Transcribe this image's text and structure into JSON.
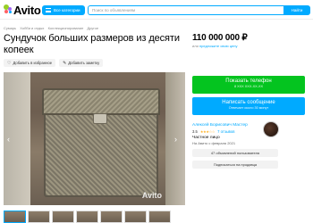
{
  "header": {
    "logo_text": "Avito",
    "categories_label": "Все категории",
    "search_placeholder": "Поиск по объявлениям",
    "search_button": "Найти"
  },
  "breadcrumb": [
    "Сумарь",
    "Хобби и отдых",
    "Коллекционирование",
    "Другое"
  ],
  "listing": {
    "title": "Сундучок больших размеров из десяти копеек",
    "favorite_label": "Добавить в избранное",
    "note_label": "Добавить заметку",
    "watermark": "Avito"
  },
  "price": {
    "value": "110 000 000 ₽",
    "sub_prefix": "или ",
    "sub_link": "предложите свою цену"
  },
  "contact": {
    "call_label": "Показать телефон",
    "call_sub": "8 XXX XXX-XX-XX",
    "message_label": "Написать сообщение",
    "message_sub": "Отвечает около 30 минут"
  },
  "seller": {
    "name": "Алексей Борисович Мастер",
    "rating": "3.5",
    "stars": "★★★☆☆",
    "reviews": "7 отзывов",
    "type": "Частное лицо",
    "since": "На Авито с февраля 2021",
    "ads_count": "47 объявлений пользователя",
    "follow_label": "Подписаться на продавца"
  },
  "icons": {
    "heart": "heart-icon",
    "note": "note-icon",
    "prev": "chevron-left-icon",
    "next": "chevron-right-icon",
    "menu": "menu-icon"
  },
  "colors": {
    "accent": "#00aaff",
    "call": "#04c41f"
  }
}
